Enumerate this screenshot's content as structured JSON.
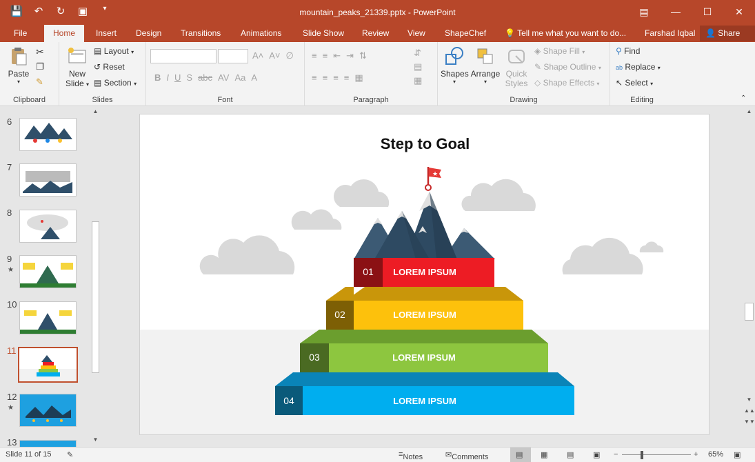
{
  "window": {
    "title": "mountain_peaks_21339.pptx - PowerPoint"
  },
  "tabs": [
    {
      "label": "File"
    },
    {
      "label": "Home"
    },
    {
      "label": "Insert"
    },
    {
      "label": "Design"
    },
    {
      "label": "Transitions"
    },
    {
      "label": "Animations"
    },
    {
      "label": "Slide Show"
    },
    {
      "label": "Review"
    },
    {
      "label": "View"
    },
    {
      "label": "ShapeChef"
    }
  ],
  "tell_me": "Tell me what you want to do...",
  "user": "Farshad Iqbal",
  "share": "Share",
  "ribbon": {
    "clipboard": {
      "label": "Clipboard",
      "paste": "Paste"
    },
    "slides": {
      "label": "Slides",
      "new_slide_1": "New",
      "new_slide_2": "Slide",
      "layout": "Layout",
      "reset": "Reset",
      "section": "Section"
    },
    "font": {
      "label": "Font"
    },
    "paragraph": {
      "label": "Paragraph"
    },
    "drawing": {
      "label": "Drawing",
      "shapes": "Shapes",
      "arrange": "Arrange",
      "quick_1": "Quick",
      "quick_2": "Styles",
      "fill": "Shape Fill",
      "outline": "Shape Outline",
      "effects": "Shape Effects"
    },
    "editing": {
      "label": "Editing",
      "find": "Find",
      "replace": "Replace",
      "select": "Select"
    }
  },
  "thumbnails": [
    {
      "num": "6",
      "star": ""
    },
    {
      "num": "7",
      "star": ""
    },
    {
      "num": "8",
      "star": ""
    },
    {
      "num": "9",
      "star": "★"
    },
    {
      "num": "10",
      "star": ""
    },
    {
      "num": "11",
      "star": ""
    },
    {
      "num": "12",
      "star": "★"
    },
    {
      "num": "13",
      "star": ""
    }
  ],
  "slide": {
    "title": "Step to Goal",
    "steps": [
      {
        "num": "01",
        "label": "LOREM IPSUM"
      },
      {
        "num": "02",
        "label": "LOREM IPSUM"
      },
      {
        "num": "03",
        "label": "LOREM IPSUM"
      },
      {
        "num": "04",
        "label": "LOREM IPSUM"
      }
    ]
  },
  "status": {
    "slide_info": "Slide 11 of 15",
    "notes": "Notes",
    "comments": "Comments",
    "zoom": "65%"
  },
  "colors": {
    "brand": "#b7472a",
    "step1": "#ed1c24",
    "step2": "#fdc10c",
    "step3": "#8dc63f",
    "step4": "#00aeef"
  }
}
